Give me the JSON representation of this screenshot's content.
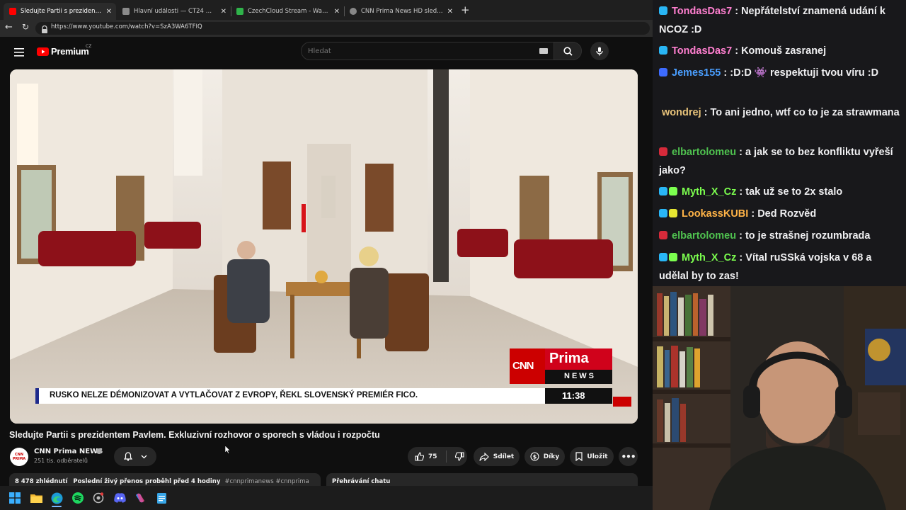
{
  "browser": {
    "tabs": [
      {
        "title": "Sledujte Partii s prezidentem Pavle",
        "favicon_color": "#ff0000"
      },
      {
        "title": "Hlavní události — ČT24 — Česká",
        "favicon_color": "#8a8a8a"
      },
      {
        "title": "CzechCloud Stream - Watch Live",
        "favicon_color": "#2fb34a"
      },
      {
        "title": "CNN Prima News HD sledujte onl",
        "favicon_color": "#888888"
      }
    ],
    "url": "https://www.youtube.com/watch?v=SzA3WA6TFIQ"
  },
  "youtube": {
    "logo_text": "Premium",
    "region": "CZ",
    "search_placeholder": "Hledat",
    "video": {
      "ticker_text": "RUSKO NELZE DÉMONIZOVAT A VYTLAČOVAT Z EVROPY, ŘEKL SLOVENSKÝ PREMIÉR FICO.",
      "ticker_time": "11:38",
      "brand_top": "CNN",
      "brand_prima": "Prima",
      "brand_news": "NEWS"
    },
    "title": "Sledujte Partii s prezidentem Pavlem. Exkluzivní rozhovor o sporech s vládou i rozpočtu",
    "channel": {
      "name": "CNN Prima NEWS",
      "subscribers": "251 tis. odběratelů",
      "avatar_text": "CNN PRIMA"
    },
    "actions": {
      "likes": "75",
      "share": "Sdílet",
      "thanks": "Díky",
      "save": "Uložit"
    },
    "description": {
      "views": "8 478 zhlédnutí",
      "status": "Poslední živý přenos proběhl před 4 hodiny",
      "tags": "#cnnprimanews #cnnprima"
    },
    "chat_replay": "Přehrávání chatu"
  },
  "chat": {
    "messages": [
      {
        "user": "TondasDas7",
        "color": "#ff7fd0",
        "text": "Nepřátelství znamená udání k NCOZ :D",
        "badges": [
          "#29b6f6"
        ]
      },
      {
        "user": "TondasDas7",
        "color": "#ff7fd0",
        "text": "Komouš zasranej",
        "badges": [
          "#29b6f6"
        ]
      },
      {
        "user": "Jemes155",
        "color": "#4a9eff",
        "text": ":D:D 👾 respektuji tvou víru :D",
        "badges": [
          "#3d6bff"
        ]
      },
      {
        "user": "wondrej",
        "color": "#e8c37a",
        "text": "To ani jedno, wtf co to je za strawmana",
        "badges": []
      },
      {
        "user": "elbartolomeu",
        "color": "#4fc14f",
        "text": "a jak se to bez konfliktu vyřeší jako?",
        "badges": [
          "#d62a3a"
        ]
      },
      {
        "user": "Myth_X_Cz",
        "color": "#7cff4f",
        "text": "tak už se to 2x stalo",
        "badges": [
          "#29b6f6",
          "#7cff4f"
        ]
      },
      {
        "user": "LookassKUBI",
        "color": "#ffb347",
        "text": "Ded Rozvěd",
        "badges": [
          "#29b6f6",
          "#e6e632"
        ]
      },
      {
        "user": "elbartolomeu",
        "color": "#4fc14f",
        "text": "to je strašnej rozumbrada",
        "badges": [
          "#d62a3a"
        ]
      },
      {
        "user": "Myth_X_Cz",
        "color": "#7cff4f",
        "text": "Vítal ruSSká vojska v 68 a udělal by to zas!",
        "badges": [
          "#29b6f6",
          "#7cff4f"
        ]
      }
    ]
  },
  "taskbar": {
    "apps": [
      "windows-start",
      "file-explorer",
      "edge",
      "spotify",
      "app-settings",
      "discord",
      "copilot",
      "notepad"
    ]
  }
}
